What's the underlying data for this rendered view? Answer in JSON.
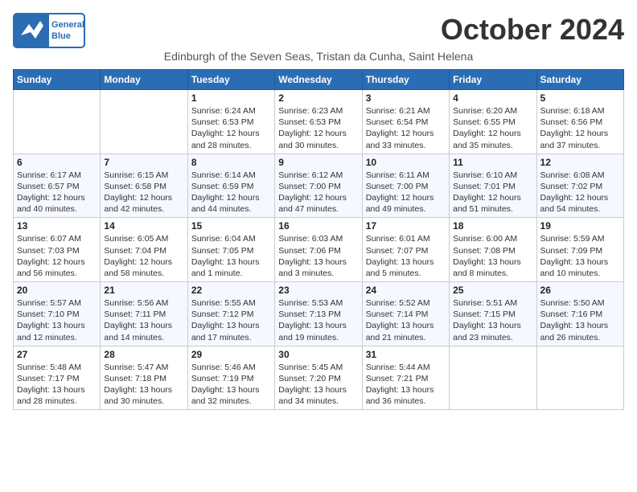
{
  "header": {
    "logo_line1": "General",
    "logo_line2": "Blue",
    "month": "October 2024",
    "subtitle": "Edinburgh of the Seven Seas, Tristan da Cunha, Saint Helena"
  },
  "weekdays": [
    "Sunday",
    "Monday",
    "Tuesday",
    "Wednesday",
    "Thursday",
    "Friday",
    "Saturday"
  ],
  "weeks": [
    [
      {
        "day": "",
        "info": ""
      },
      {
        "day": "",
        "info": ""
      },
      {
        "day": "1",
        "info": "Sunrise: 6:24 AM\nSunset: 6:53 PM\nDaylight: 12 hours and 28 minutes."
      },
      {
        "day": "2",
        "info": "Sunrise: 6:23 AM\nSunset: 6:53 PM\nDaylight: 12 hours and 30 minutes."
      },
      {
        "day": "3",
        "info": "Sunrise: 6:21 AM\nSunset: 6:54 PM\nDaylight: 12 hours and 33 minutes."
      },
      {
        "day": "4",
        "info": "Sunrise: 6:20 AM\nSunset: 6:55 PM\nDaylight: 12 hours and 35 minutes."
      },
      {
        "day": "5",
        "info": "Sunrise: 6:18 AM\nSunset: 6:56 PM\nDaylight: 12 hours and 37 minutes."
      }
    ],
    [
      {
        "day": "6",
        "info": "Sunrise: 6:17 AM\nSunset: 6:57 PM\nDaylight: 12 hours and 40 minutes."
      },
      {
        "day": "7",
        "info": "Sunrise: 6:15 AM\nSunset: 6:58 PM\nDaylight: 12 hours and 42 minutes."
      },
      {
        "day": "8",
        "info": "Sunrise: 6:14 AM\nSunset: 6:59 PM\nDaylight: 12 hours and 44 minutes."
      },
      {
        "day": "9",
        "info": "Sunrise: 6:12 AM\nSunset: 7:00 PM\nDaylight: 12 hours and 47 minutes."
      },
      {
        "day": "10",
        "info": "Sunrise: 6:11 AM\nSunset: 7:00 PM\nDaylight: 12 hours and 49 minutes."
      },
      {
        "day": "11",
        "info": "Sunrise: 6:10 AM\nSunset: 7:01 PM\nDaylight: 12 hours and 51 minutes."
      },
      {
        "day": "12",
        "info": "Sunrise: 6:08 AM\nSunset: 7:02 PM\nDaylight: 12 hours and 54 minutes."
      }
    ],
    [
      {
        "day": "13",
        "info": "Sunrise: 6:07 AM\nSunset: 7:03 PM\nDaylight: 12 hours and 56 minutes."
      },
      {
        "day": "14",
        "info": "Sunrise: 6:05 AM\nSunset: 7:04 PM\nDaylight: 12 hours and 58 minutes."
      },
      {
        "day": "15",
        "info": "Sunrise: 6:04 AM\nSunset: 7:05 PM\nDaylight: 13 hours and 1 minute."
      },
      {
        "day": "16",
        "info": "Sunrise: 6:03 AM\nSunset: 7:06 PM\nDaylight: 13 hours and 3 minutes."
      },
      {
        "day": "17",
        "info": "Sunrise: 6:01 AM\nSunset: 7:07 PM\nDaylight: 13 hours and 5 minutes."
      },
      {
        "day": "18",
        "info": "Sunrise: 6:00 AM\nSunset: 7:08 PM\nDaylight: 13 hours and 8 minutes."
      },
      {
        "day": "19",
        "info": "Sunrise: 5:59 AM\nSunset: 7:09 PM\nDaylight: 13 hours and 10 minutes."
      }
    ],
    [
      {
        "day": "20",
        "info": "Sunrise: 5:57 AM\nSunset: 7:10 PM\nDaylight: 13 hours and 12 minutes."
      },
      {
        "day": "21",
        "info": "Sunrise: 5:56 AM\nSunset: 7:11 PM\nDaylight: 13 hours and 14 minutes."
      },
      {
        "day": "22",
        "info": "Sunrise: 5:55 AM\nSunset: 7:12 PM\nDaylight: 13 hours and 17 minutes."
      },
      {
        "day": "23",
        "info": "Sunrise: 5:53 AM\nSunset: 7:13 PM\nDaylight: 13 hours and 19 minutes."
      },
      {
        "day": "24",
        "info": "Sunrise: 5:52 AM\nSunset: 7:14 PM\nDaylight: 13 hours and 21 minutes."
      },
      {
        "day": "25",
        "info": "Sunrise: 5:51 AM\nSunset: 7:15 PM\nDaylight: 13 hours and 23 minutes."
      },
      {
        "day": "26",
        "info": "Sunrise: 5:50 AM\nSunset: 7:16 PM\nDaylight: 13 hours and 26 minutes."
      }
    ],
    [
      {
        "day": "27",
        "info": "Sunrise: 5:48 AM\nSunset: 7:17 PM\nDaylight: 13 hours and 28 minutes."
      },
      {
        "day": "28",
        "info": "Sunrise: 5:47 AM\nSunset: 7:18 PM\nDaylight: 13 hours and 30 minutes."
      },
      {
        "day": "29",
        "info": "Sunrise: 5:46 AM\nSunset: 7:19 PM\nDaylight: 13 hours and 32 minutes."
      },
      {
        "day": "30",
        "info": "Sunrise: 5:45 AM\nSunset: 7:20 PM\nDaylight: 13 hours and 34 minutes."
      },
      {
        "day": "31",
        "info": "Sunrise: 5:44 AM\nSunset: 7:21 PM\nDaylight: 13 hours and 36 minutes."
      },
      {
        "day": "",
        "info": ""
      },
      {
        "day": "",
        "info": ""
      }
    ]
  ]
}
